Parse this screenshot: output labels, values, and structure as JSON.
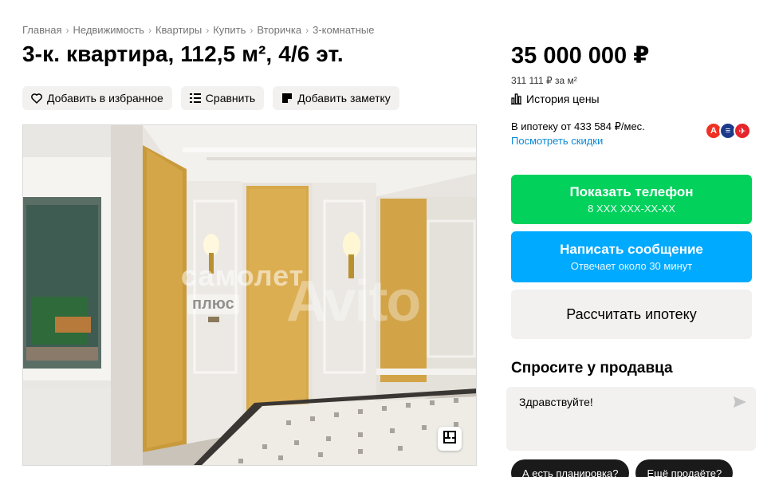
{
  "breadcrumb": [
    "Главная",
    "Недвижимость",
    "Квартиры",
    "Купить",
    "Вторичка",
    "3-комнатные"
  ],
  "title": "3-к. квартира, 112,5 м², 4/6 эт.",
  "actions": {
    "favorite": "Добавить в избранное",
    "compare": "Сравнить",
    "note": "Добавить заметку"
  },
  "gallery": {
    "watermark_brand": "самолет",
    "watermark_plus": "плюс",
    "watermark_avito": "Avito",
    "plan_icon": "floor-plan-icon"
  },
  "price": {
    "value": "35 000 000 ₽",
    "per_m2": "311 111 ₽ за м²",
    "history": "История цены"
  },
  "mortgage": {
    "text": "В ипотеку от 433 584 ₽/мес.",
    "discounts": "Посмотреть скидки",
    "banks": [
      {
        "letter": "А",
        "color": "#ef3124"
      },
      {
        "letter": "≡",
        "color": "#1d3a8a"
      },
      {
        "letter": "✈",
        "color": "#e4262c"
      }
    ]
  },
  "buttons": {
    "phone_main": "Показать телефон",
    "phone_sub": "8 XXX XXX-XX-XX",
    "msg_main": "Написать сообщение",
    "msg_sub": "Отвечает около 30 минут",
    "mortgage_calc": "Рассчитать ипотеку"
  },
  "ask": {
    "title": "Спросите у продавца",
    "message": "Здравствуйте!",
    "chips": [
      "А есть планировка?",
      "Ещё продаёте?"
    ]
  },
  "colors": {
    "green": "#02d15c",
    "blue": "#00aaff",
    "link": "#0a88d4",
    "chip": "#1a1a1a"
  }
}
